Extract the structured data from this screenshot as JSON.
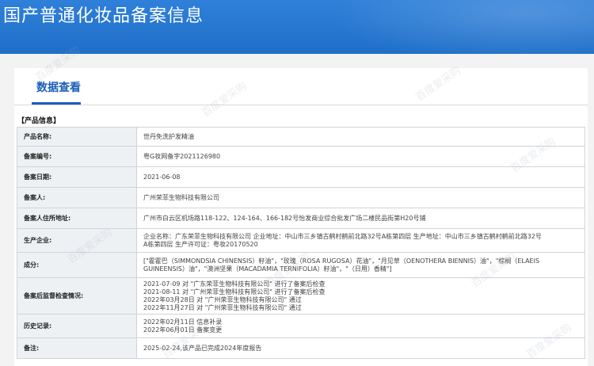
{
  "banner": {
    "title": "国产普通化妆品备案信息"
  },
  "tab": {
    "label": "数据查看"
  },
  "section": {
    "heading": "【产品信息】"
  },
  "rows": {
    "product_name": {
      "label": "产品名称:",
      "value": "世丹免洗护发精油"
    },
    "record_number": {
      "label": "备案编号:",
      "value": "粤G妆网备字2021126980"
    },
    "record_date": {
      "label": "备案日期:",
      "value": "2021-06-08"
    },
    "registrant": {
      "label": "备案人:",
      "value": "广州荣菲生物科技有限公司"
    },
    "registrant_address": {
      "label": "备案人住所地址:",
      "value": "广州市白云区机场路118-122、124-164、166-182号怡发商业综合批发广场二楼民品街第H20号铺"
    },
    "manufacturer": {
      "label": "生产企业:",
      "lines": [
        "企业名称：广东荣菲生物科技有限公司 企业地址：中山市三乡镇古鹤村鹤前北路32号A栋第四层 生产地址：中山市三乡镇古鹤村鹤前北路32号",
        "A栋第四层 生产许可证：粤妆20170520"
      ]
    },
    "ingredients": {
      "label": "成分:",
      "lines": [
        "[\"霍霍巴（SIMMONDSIA CHINENSIS）籽油\"，\"玫瑰（ROSA RUGOSA）花油\"，\"月见草（OENOTHERA BIENNIS）油\"，\"棕榈（ELAEIS",
        "GUINEENSIS）油\"，\"澳洲坚果（MACADAMIA TERNIFOLIA）籽油\"，\"（日用）香精\"]"
      ]
    },
    "post_inspection": {
      "label": "备案后监督检查情况:",
      "lines": [
        "2021-07-09 对 \"广东荣菲生物科技有限公司\" 进行了备案后检查",
        "2021-08-11 对 \"广州荣菲生物科技有限公司\" 进行了备案后检查",
        "2022年03月28日 对 \"广州荣菲生物科技有限公司\" 通过",
        "2022年11月27日 对 \"广州荣菲生物科技有限公司\" 通过"
      ]
    },
    "history": {
      "label": "历史记录:",
      "lines": [
        "2022年02月11日 信息补录",
        "2022年06月01日 备案变更"
      ]
    },
    "remarks": {
      "label": "备注:",
      "value": "2025-02-24,该产品已完成2024年度报告"
    }
  },
  "watermark": {
    "text": "百度爱采购"
  },
  "colors": {
    "banner": "#2678d4",
    "tab_active": "#1a5fb8",
    "label_bg": "#eef1f4",
    "border": "#cfd4da"
  }
}
